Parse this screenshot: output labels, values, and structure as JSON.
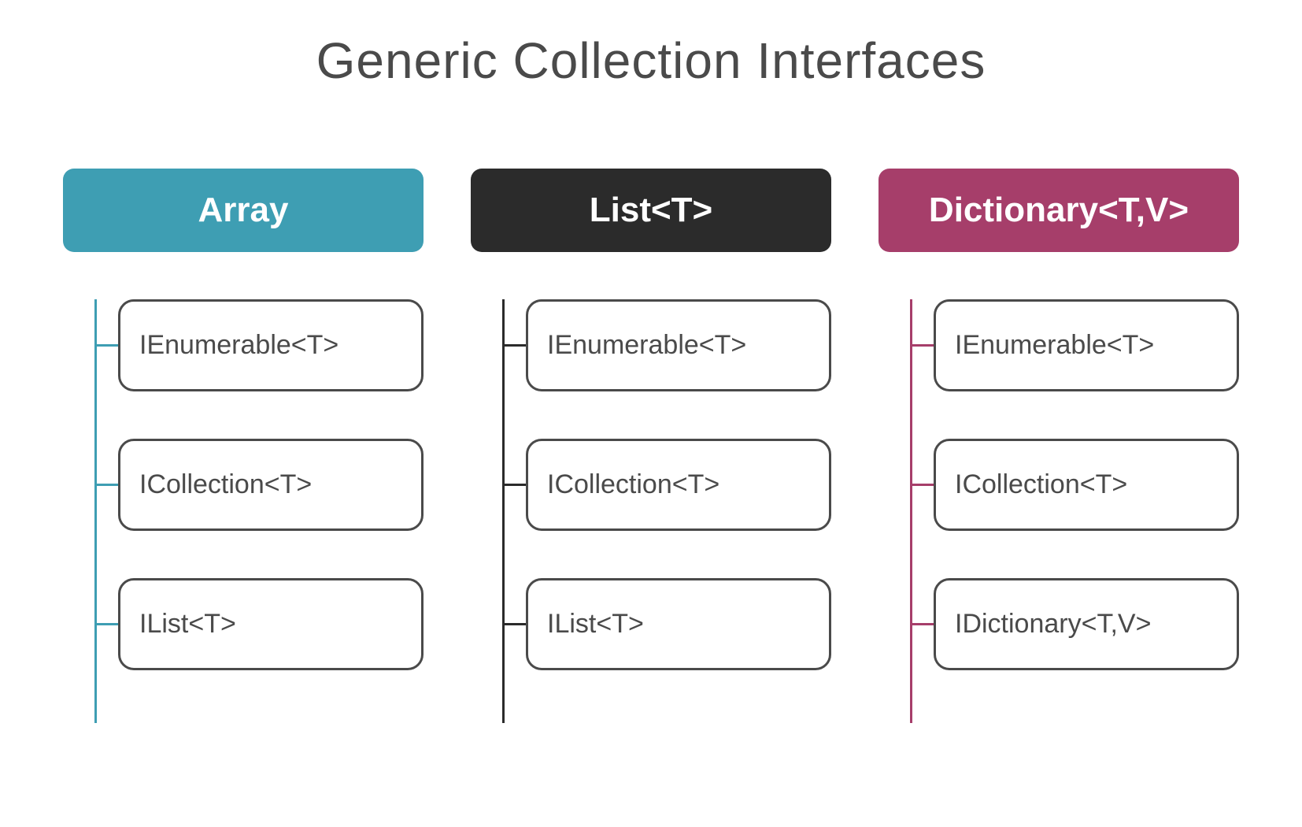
{
  "title": "Generic Collection Interfaces",
  "columns": [
    {
      "header": "Array",
      "color": "#3e9eb3",
      "items": [
        "IEnumerable<T>",
        "ICollection<T>",
        "IList<T>"
      ]
    },
    {
      "header": "List<T>",
      "color": "#2b2b2b",
      "items": [
        "IEnumerable<T>",
        "ICollection<T>",
        "IList<T>"
      ]
    },
    {
      "header": "Dictionary<T,V>",
      "color": "#a63e6a",
      "items": [
        "IEnumerable<T>",
        "ICollection<T>",
        "IDictionary<T,V>"
      ]
    }
  ]
}
